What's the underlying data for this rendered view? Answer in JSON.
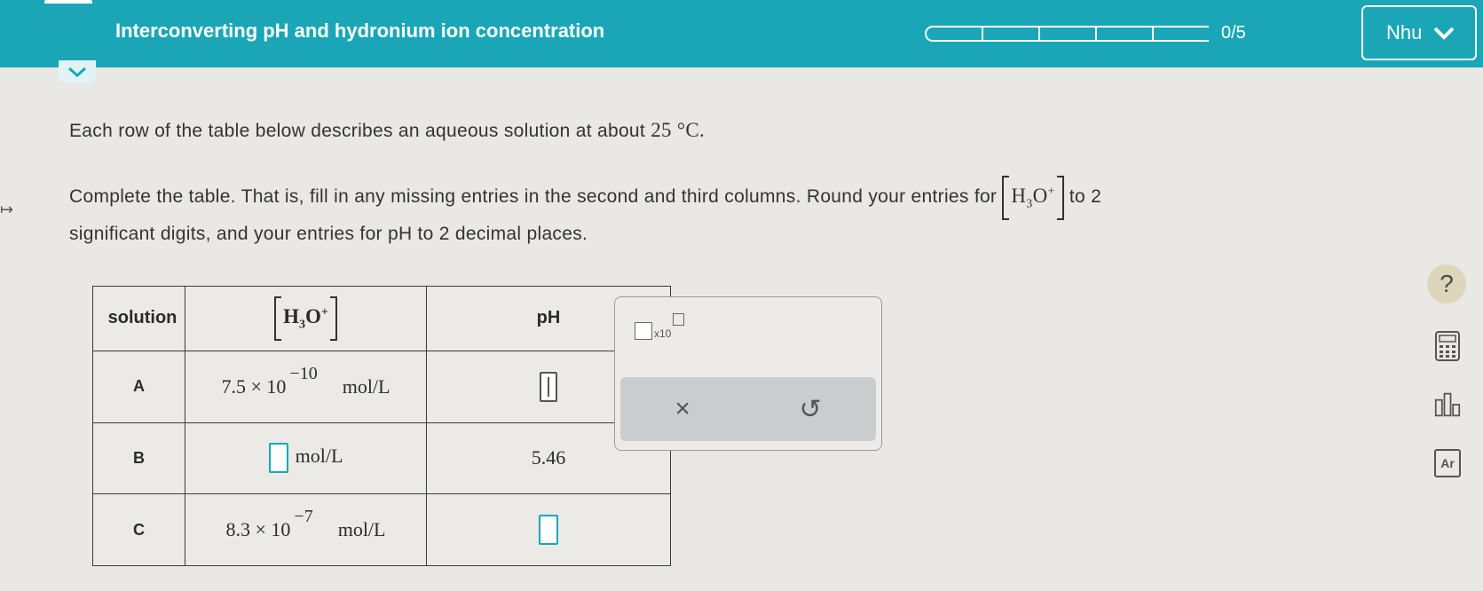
{
  "header": {
    "title": "Interconverting pH and hydronium ion concentration",
    "progress_count": "0/5",
    "user_name": "Nhu"
  },
  "problem": {
    "line1_text": "Each row of the table below describes an aqueous solution at about ",
    "line1_temp": "25 °C.",
    "line2_text": "Complete the table. That is, fill in any missing entries in the second and third columns. Round your entries for ",
    "line2_end": "to 2",
    "line3_text": "significant digits, and your entries for pH to 2 decimal places."
  },
  "table": {
    "headers": [
      "solution",
      "H3O+",
      "pH"
    ],
    "rows": [
      {
        "label": "A",
        "mantissa": "7.5 × 10",
        "exponent": "−10",
        "unit": "mol/L",
        "ph": ""
      },
      {
        "label": "B",
        "mantissa": "",
        "exponent": "",
        "unit": "mol/L",
        "ph": "5.46"
      },
      {
        "label": "C",
        "mantissa": "8.3 × 10",
        "exponent": "−7",
        "unit": "mol/L",
        "ph": ""
      }
    ]
  },
  "toolbox": {
    "x10_label": "x10",
    "clear_symbol": "×",
    "undo_symbol": "↺"
  },
  "side_tools": {
    "help_symbol": "?",
    "ar_label": "Ar"
  },
  "colors": {
    "header_bg": "#1aa6b7",
    "input_border": "#19a7b8",
    "page_bg": "#e9e8e4"
  }
}
